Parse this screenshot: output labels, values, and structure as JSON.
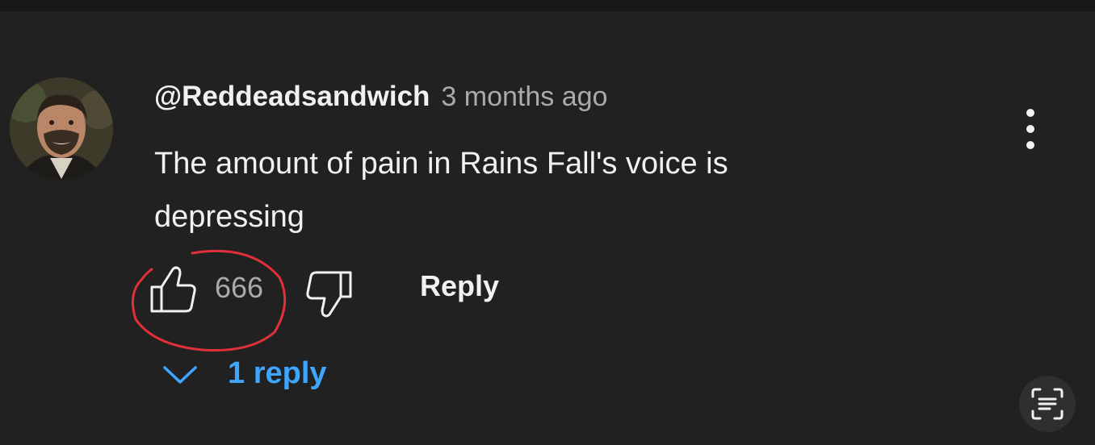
{
  "comment": {
    "author": "@Reddeadsandwich",
    "timestamp": "3 months ago",
    "text_lines": [
      "The amount of pain in Rains Fall's voice is",
      "depressing"
    ],
    "avatar_icon": "user-avatar-photo",
    "menu_icon": "more-vertical-icon"
  },
  "actions": {
    "like_count": "666",
    "like_icon": "thumbs-up-icon",
    "dislike_icon": "thumbs-down-icon",
    "reply_label": "Reply"
  },
  "replies": {
    "label": "1 reply",
    "icon": "chevron-down-icon"
  },
  "overlay": {
    "icon": "text-scan-icon"
  },
  "colors": {
    "background": "#212121",
    "text": "#f1f1f1",
    "secondary_text": "#aaaaaa",
    "link": "#3ea6ff",
    "annotation": "#e0303a"
  }
}
